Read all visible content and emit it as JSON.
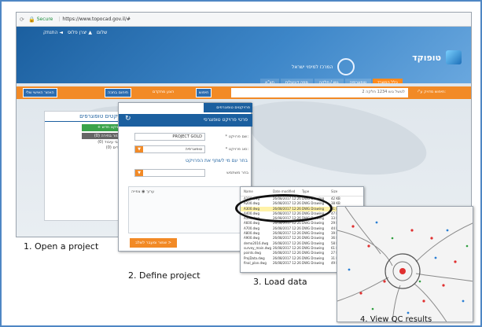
{
  "browser": {
    "secure_label": "Secure",
    "url": "https://www.topocad.gov.il/#"
  },
  "site": {
    "top_links": [
      "התנתק ◄",
      "יצרן פלוס ▲",
      "שלום"
    ],
    "brand": "טופוקד",
    "gov_label": "המרכז למיפוי ישראל",
    "tabs": [
      "כלל המשרד",
      "טופוגרפיה",
      "גוש / חלקה",
      "מפה דיגיטלית",
      "תצ\"א"
    ],
    "search": {
      "label": "חיפוש מדויק ע\"י:",
      "input_value": "לטשל גוש 1234 חלקה 2",
      "buttons": [
        "האזור האישי שלי",
        "תיחום בחכה",
        "הצע מתקדם",
        "חיפוש"
      ]
    },
    "projects_panel": {
      "title": "פרויקטים טופוגרפים",
      "new_button": "+ פרויקט חדש",
      "rows": [
        "האזור בחירה (0)",
        "(0) בשלבי עיבוד",
        "(0) שמורים"
      ]
    }
  },
  "dialog": {
    "tab_label": "פרויקטים טופוגרפים",
    "title": "פרטי פרויקט טופוגרפי",
    "fields": [
      {
        "label": "* שם פרויקט:",
        "value": "PROJECT GOLD"
      },
      {
        "label": "* סוג פרויקט:",
        "value": "טופוגרפיה"
      }
    ],
    "section_title": "בחר עם מי לשתף את הפרויקט",
    "share_label": "בחר משתמש",
    "option_label": "ערוך  ◉ צפייה",
    "save_button": "שמור ומעבר לשלב >"
  },
  "load": {
    "columns": [
      "Name",
      "Date modified",
      "Type",
      "Size"
    ],
    "files": [
      {
        "name": "A100.dwg",
        "date": "26/08/2017 12:26",
        "type": "DWG Drawing",
        "size": "42 KB"
      },
      {
        "name": "A200.dwg",
        "date": "26/08/2017 12:26",
        "type": "DWG Drawing",
        "size": "38 KB"
      },
      {
        "name": "A300.dwg",
        "date": "26/08/2017 12:26",
        "type": "DWG Drawing",
        "size": "51 KB",
        "highlight": true
      },
      {
        "name": "A400.dwg",
        "date": "26/08/2017 12:26",
        "type": "DWG Drawing",
        "size": "47 KB"
      },
      {
        "name": "A500.dwg",
        "date": "26/08/2017 12:26",
        "type": "DWG Drawing",
        "size": "33 KB"
      },
      {
        "name": "A600.dwg",
        "date": "26/08/2017 12:26",
        "type": "DWG Drawing",
        "size": "29 KB"
      },
      {
        "name": "A700.dwg",
        "date": "26/08/2017 12:26",
        "type": "DWG Drawing",
        "size": "44 KB"
      },
      {
        "name": "A800.dwg",
        "date": "26/08/2017 12:26",
        "type": "DWG Drawing",
        "size": "39 KB"
      },
      {
        "name": "A900.dwg",
        "date": "26/08/2017 12:26",
        "type": "DWG Drawing",
        "size": "36 KB"
      },
      {
        "name": "demo2016.dwg",
        "date": "26/08/2017 12:26",
        "type": "DWG Drawing",
        "size": "58 KB"
      },
      {
        "name": "survey_main.dwg",
        "date": "26/08/2017 12:26",
        "type": "DWG Drawing",
        "size": "61 KB"
      },
      {
        "name": "points.dwg",
        "date": "26/08/2017 12:26",
        "type": "DWG Drawing",
        "size": "27 KB"
      },
      {
        "name": "ProjData.dwg",
        "date": "26/08/2017 12:26",
        "type": "DWG Drawing",
        "size": "31 KB"
      },
      {
        "name": "final_plan.dwg",
        "date": "26/08/2017 12:26",
        "type": "DWG Drawing",
        "size": "49 KB"
      }
    ]
  },
  "captions": {
    "step1": "1. Open a project",
    "step2": "2. Define project",
    "step3": "3. Load data",
    "step4": "4.  View QC results"
  },
  "colors": {
    "frame_border": "#4f87c4",
    "accent_orange": "#f28a26",
    "brand_blue": "#1b5f9f",
    "highlight_yellow": "#fff2a8"
  }
}
